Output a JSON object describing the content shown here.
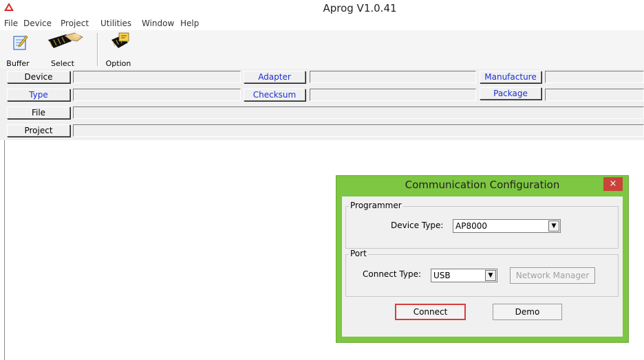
{
  "window": {
    "title": "Aprog V1.0.41"
  },
  "menu": [
    "File",
    "Device",
    "Project",
    "Utilities",
    "Window",
    "Help"
  ],
  "toolbar": {
    "buffer": "Buffer",
    "select": "Select",
    "option": "Option"
  },
  "info": {
    "device": "Device",
    "adapter": "Adapter",
    "manufacture": "Manufacture",
    "type": "Type",
    "checksum": "Checksum",
    "package": "Package",
    "file": "File",
    "project": "Project"
  },
  "dialog": {
    "title": "Communication Configuration",
    "close": "×",
    "programmer_group": "Programmer",
    "device_type_label": "Device Type:",
    "device_type_value": "AP8000",
    "port_group": "Port",
    "connect_type_label": "Connect Type:",
    "connect_type_value": "USB",
    "network_manager": "Network Manager",
    "connect": "Connect",
    "demo": "Demo"
  },
  "colors": {
    "dialog_frame": "#7ec742",
    "label_blue": "#1a2fd2",
    "focus_red": "#d93b3b",
    "close_red": "#c9433a"
  }
}
